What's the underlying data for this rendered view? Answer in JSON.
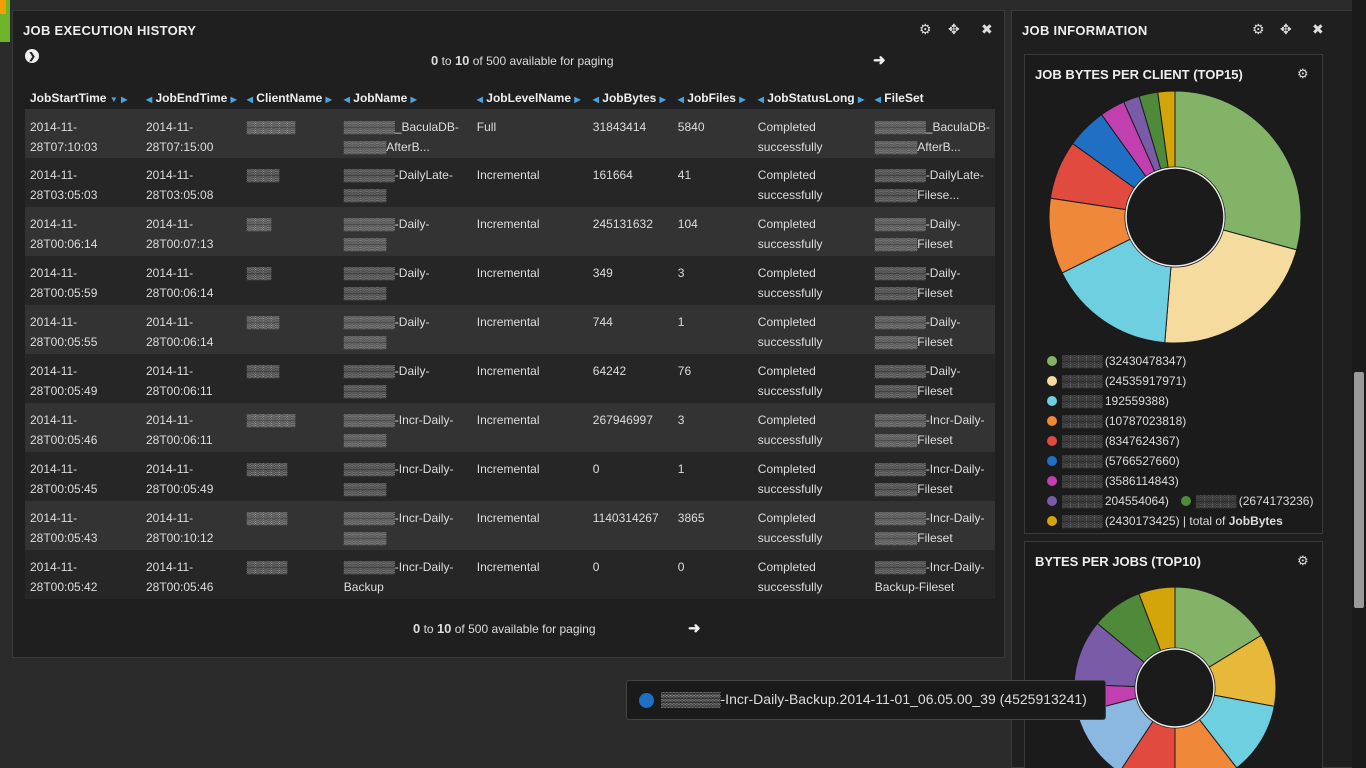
{
  "history": {
    "title": "JOB EXECUTION HISTORY",
    "pager_top": {
      "from": "0",
      "to_word": "to",
      "to": "10",
      "suffix": "of 500 available for paging"
    },
    "pager_bottom": {
      "from": "0",
      "to_word": "to",
      "to": "10",
      "suffix": "of 500 available for paging"
    },
    "columns": [
      "JobStartTime",
      "JobEndTime",
      "ClientName",
      "JobName",
      "JobLevelName",
      "JobBytes",
      "JobFiles",
      "JobStatusLong",
      "FileSet"
    ],
    "rows": [
      {
        "start": "2014-11-28T07:10:03",
        "end": "2014-11-28T07:15:00",
        "client": "▒▒▒▒▒▒",
        "job": "▒▒▒▒▒▒_BaculaDB-▒▒▒▒▒AfterB...",
        "level": "Full",
        "bytes": "31843414",
        "files": "5840",
        "status": "Completed successfully",
        "fileset": "▒▒▒▒▒▒_BaculaDB-▒▒▒▒▒AfterB..."
      },
      {
        "start": "2014-11-28T03:05:03",
        "end": "2014-11-28T03:05:08",
        "client": "▒▒▒▒",
        "job": "▒▒▒▒▒▒-DailyLate-▒▒▒▒▒",
        "level": "Incremental",
        "bytes": "161664",
        "files": "41",
        "status": "Completed successfully",
        "fileset": "▒▒▒▒▒▒-DailyLate-▒▒▒▒▒Filese..."
      },
      {
        "start": "2014-11-28T00:06:14",
        "end": "2014-11-28T00:07:13",
        "client": "▒▒▒",
        "job": "▒▒▒▒▒▒-Daily-▒▒▒▒▒",
        "level": "Incremental",
        "bytes": "245131632",
        "files": "104",
        "status": "Completed successfully",
        "fileset": "▒▒▒▒▒▒-Daily-▒▒▒▒▒Fileset"
      },
      {
        "start": "2014-11-28T00:05:59",
        "end": "2014-11-28T00:06:14",
        "client": "▒▒▒",
        "job": "▒▒▒▒▒▒-Daily-▒▒▒▒▒",
        "level": "Incremental",
        "bytes": "349",
        "files": "3",
        "status": "Completed successfully",
        "fileset": "▒▒▒▒▒▒-Daily-▒▒▒▒▒Fileset"
      },
      {
        "start": "2014-11-28T00:05:55",
        "end": "2014-11-28T00:06:14",
        "client": "▒▒▒▒",
        "job": "▒▒▒▒▒▒-Daily-▒▒▒▒▒",
        "level": "Incremental",
        "bytes": "744",
        "files": "1",
        "status": "Completed successfully",
        "fileset": "▒▒▒▒▒▒-Daily-▒▒▒▒▒Fileset"
      },
      {
        "start": "2014-11-28T00:05:49",
        "end": "2014-11-28T00:06:11",
        "client": "▒▒▒▒",
        "job": "▒▒▒▒▒▒-Daily-▒▒▒▒▒",
        "level": "Incremental",
        "bytes": "64242",
        "files": "76",
        "status": "Completed successfully",
        "fileset": "▒▒▒▒▒▒-Daily-▒▒▒▒▒Fileset"
      },
      {
        "start": "2014-11-28T00:05:46",
        "end": "2014-11-28T00:06:11",
        "client": "▒▒▒▒▒▒",
        "job": "▒▒▒▒▒▒-Incr-Daily-▒▒▒▒▒",
        "level": "Incremental",
        "bytes": "267946997",
        "files": "3",
        "status": "Completed successfully",
        "fileset": "▒▒▒▒▒▒-Incr-Daily-▒▒▒▒▒Fileset"
      },
      {
        "start": "2014-11-28T00:05:45",
        "end": "2014-11-28T00:05:49",
        "client": "▒▒▒▒▒",
        "job": "▒▒▒▒▒▒-Incr-Daily-▒▒▒▒▒",
        "level": "Incremental",
        "bytes": "0",
        "files": "1",
        "status": "Completed successfully",
        "fileset": "▒▒▒▒▒▒-Incr-Daily-▒▒▒▒▒Fileset"
      },
      {
        "start": "2014-11-28T00:05:43",
        "end": "2014-11-28T00:10:12",
        "client": "▒▒▒▒▒",
        "job": "▒▒▒▒▒▒-Incr-Daily-▒▒▒▒▒",
        "level": "Incremental",
        "bytes": "1140314267",
        "files": "3865",
        "status": "Completed successfully",
        "fileset": "▒▒▒▒▒▒-Incr-Daily-▒▒▒▒▒Fileset"
      },
      {
        "start": "2014-11-28T00:05:42",
        "end": "2014-11-28T00:05:46",
        "client": "▒▒▒▒▒",
        "job": "▒▒▒▒▒▒-Incr-Daily-Backup",
        "level": "Incremental",
        "bytes": "0",
        "files": "0",
        "status": "Completed successfully",
        "fileset": "▒▒▒▒▒▒-Incr-Daily-Backup-Fileset"
      }
    ]
  },
  "info": {
    "title": "JOB INFORMATION",
    "bytes_per_client": {
      "title": "JOB BYTES PER CLIENT (TOP15)",
      "legend_suffix_prefix": "| total of",
      "legend_suffix_bold": "JobBytes"
    },
    "bytes_per_jobs": {
      "title": "BYTES PER JOBS (TOP10)"
    }
  },
  "tooltip": {
    "text": "▒▒▒▒▒▒-Incr-Daily-Backup.2014-11-01_06.05.00_39 (4525913241)",
    "color": "#1f6fc5"
  },
  "chart_data": [
    {
      "type": "pie",
      "title": "JOB BYTES PER CLIENT (TOP15)",
      "legend_placement": "bottom",
      "categories": [
        "▒▒▒▒▒",
        "▒▒▒▒▒",
        "▒▒▒▒▒",
        "▒▒▒▒▒",
        "▒▒▒▒▒",
        "▒▒▒▒▒",
        "▒▒▒▒▒",
        "▒▒▒▒▒",
        "▒▒▒▒▒",
        "▒▒▒▒▒"
      ],
      "values": [
        32430478347,
        24535917971,
        18192559388,
        10787023818,
        8347624367,
        5766527660,
        3586114843,
        2304554064,
        2674173236,
        2430173425
      ],
      "labels": [
        "(32430478347)",
        "(24535917971)",
        "192559388)",
        "(10787023818)",
        "(8347624367)",
        "(5766527660)",
        "(3586114843)",
        "204554064)",
        "(2674173236)",
        "(2430173425)"
      ],
      "colors": [
        "#82b366",
        "#f5dc9e",
        "#6dcfe0",
        "#f0883a",
        "#e04a3f",
        "#1f6fc5",
        "#c23fb0",
        "#7a5ba8",
        "#4f8a3a",
        "#d4a50a"
      ]
    },
    {
      "type": "pie",
      "title": "BYTES PER JOBS (TOP10)",
      "values": [
        14,
        10,
        10,
        9,
        8,
        10,
        4,
        9,
        7,
        5
      ],
      "colors": [
        "#82b366",
        "#e8b83a",
        "#6dcfe0",
        "#f0883a",
        "#e04a3f",
        "#8ab8e0",
        "#c23fb0",
        "#7a5ba8",
        "#4f8a3a",
        "#d4a50a"
      ]
    }
  ]
}
